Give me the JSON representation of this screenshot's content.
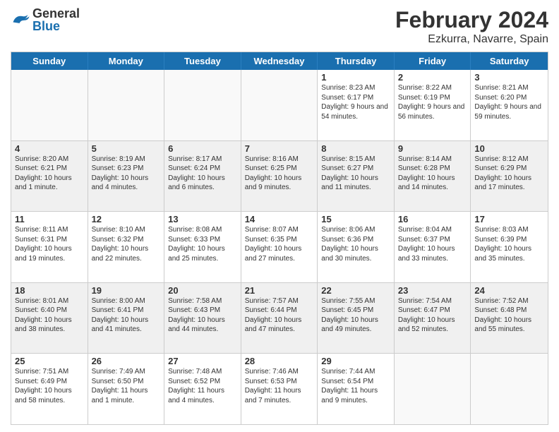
{
  "header": {
    "logo_general": "General",
    "logo_blue": "Blue",
    "month_year": "February 2024",
    "location": "Ezkurra, Navarre, Spain"
  },
  "days_of_week": [
    "Sunday",
    "Monday",
    "Tuesday",
    "Wednesday",
    "Thursday",
    "Friday",
    "Saturday"
  ],
  "weeks": [
    [
      {
        "day": "",
        "info": ""
      },
      {
        "day": "",
        "info": ""
      },
      {
        "day": "",
        "info": ""
      },
      {
        "day": "",
        "info": ""
      },
      {
        "day": "1",
        "info": "Sunrise: 8:23 AM\nSunset: 6:17 PM\nDaylight: 9 hours\nand 54 minutes."
      },
      {
        "day": "2",
        "info": "Sunrise: 8:22 AM\nSunset: 6:19 PM\nDaylight: 9 hours\nand 56 minutes."
      },
      {
        "day": "3",
        "info": "Sunrise: 8:21 AM\nSunset: 6:20 PM\nDaylight: 9 hours\nand 59 minutes."
      }
    ],
    [
      {
        "day": "4",
        "info": "Sunrise: 8:20 AM\nSunset: 6:21 PM\nDaylight: 10 hours\nand 1 minute."
      },
      {
        "day": "5",
        "info": "Sunrise: 8:19 AM\nSunset: 6:23 PM\nDaylight: 10 hours\nand 4 minutes."
      },
      {
        "day": "6",
        "info": "Sunrise: 8:17 AM\nSunset: 6:24 PM\nDaylight: 10 hours\nand 6 minutes."
      },
      {
        "day": "7",
        "info": "Sunrise: 8:16 AM\nSunset: 6:25 PM\nDaylight: 10 hours\nand 9 minutes."
      },
      {
        "day": "8",
        "info": "Sunrise: 8:15 AM\nSunset: 6:27 PM\nDaylight: 10 hours\nand 11 minutes."
      },
      {
        "day": "9",
        "info": "Sunrise: 8:14 AM\nSunset: 6:28 PM\nDaylight: 10 hours\nand 14 minutes."
      },
      {
        "day": "10",
        "info": "Sunrise: 8:12 AM\nSunset: 6:29 PM\nDaylight: 10 hours\nand 17 minutes."
      }
    ],
    [
      {
        "day": "11",
        "info": "Sunrise: 8:11 AM\nSunset: 6:31 PM\nDaylight: 10 hours\nand 19 minutes."
      },
      {
        "day": "12",
        "info": "Sunrise: 8:10 AM\nSunset: 6:32 PM\nDaylight: 10 hours\nand 22 minutes."
      },
      {
        "day": "13",
        "info": "Sunrise: 8:08 AM\nSunset: 6:33 PM\nDaylight: 10 hours\nand 25 minutes."
      },
      {
        "day": "14",
        "info": "Sunrise: 8:07 AM\nSunset: 6:35 PM\nDaylight: 10 hours\nand 27 minutes."
      },
      {
        "day": "15",
        "info": "Sunrise: 8:06 AM\nSunset: 6:36 PM\nDaylight: 10 hours\nand 30 minutes."
      },
      {
        "day": "16",
        "info": "Sunrise: 8:04 AM\nSunset: 6:37 PM\nDaylight: 10 hours\nand 33 minutes."
      },
      {
        "day": "17",
        "info": "Sunrise: 8:03 AM\nSunset: 6:39 PM\nDaylight: 10 hours\nand 35 minutes."
      }
    ],
    [
      {
        "day": "18",
        "info": "Sunrise: 8:01 AM\nSunset: 6:40 PM\nDaylight: 10 hours\nand 38 minutes."
      },
      {
        "day": "19",
        "info": "Sunrise: 8:00 AM\nSunset: 6:41 PM\nDaylight: 10 hours\nand 41 minutes."
      },
      {
        "day": "20",
        "info": "Sunrise: 7:58 AM\nSunset: 6:43 PM\nDaylight: 10 hours\nand 44 minutes."
      },
      {
        "day": "21",
        "info": "Sunrise: 7:57 AM\nSunset: 6:44 PM\nDaylight: 10 hours\nand 47 minutes."
      },
      {
        "day": "22",
        "info": "Sunrise: 7:55 AM\nSunset: 6:45 PM\nDaylight: 10 hours\nand 49 minutes."
      },
      {
        "day": "23",
        "info": "Sunrise: 7:54 AM\nSunset: 6:47 PM\nDaylight: 10 hours\nand 52 minutes."
      },
      {
        "day": "24",
        "info": "Sunrise: 7:52 AM\nSunset: 6:48 PM\nDaylight: 10 hours\nand 55 minutes."
      }
    ],
    [
      {
        "day": "25",
        "info": "Sunrise: 7:51 AM\nSunset: 6:49 PM\nDaylight: 10 hours\nand 58 minutes."
      },
      {
        "day": "26",
        "info": "Sunrise: 7:49 AM\nSunset: 6:50 PM\nDaylight: 11 hours\nand 1 minute."
      },
      {
        "day": "27",
        "info": "Sunrise: 7:48 AM\nSunset: 6:52 PM\nDaylight: 11 hours\nand 4 minutes."
      },
      {
        "day": "28",
        "info": "Sunrise: 7:46 AM\nSunset: 6:53 PM\nDaylight: 11 hours\nand 7 minutes."
      },
      {
        "day": "29",
        "info": "Sunrise: 7:44 AM\nSunset: 6:54 PM\nDaylight: 11 hours\nand 9 minutes."
      },
      {
        "day": "",
        "info": ""
      },
      {
        "day": "",
        "info": ""
      }
    ]
  ]
}
